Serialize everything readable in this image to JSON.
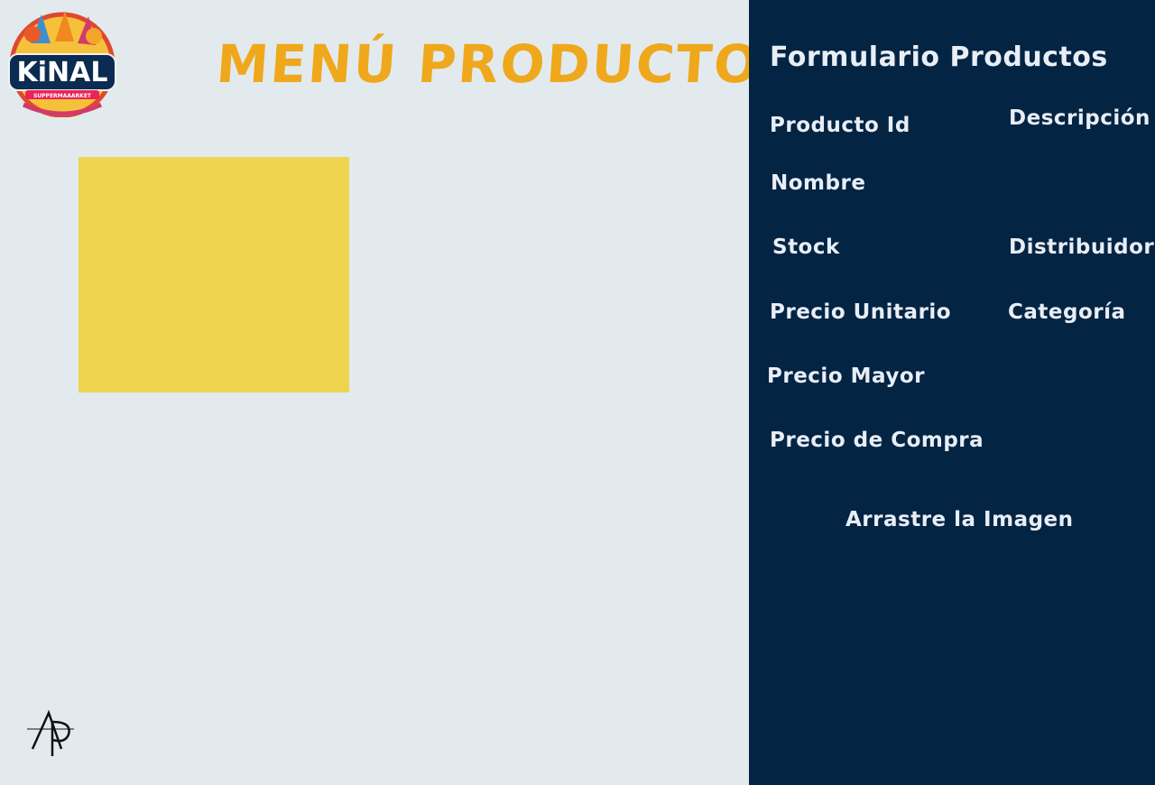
{
  "header": {
    "title": "MENÚ PRODUCTOS",
    "logo": {
      "name": "kinal-supermarket-logo",
      "text": "KiNAL",
      "subtext": "SUPPERMAAARKET"
    }
  },
  "main": {
    "image_preview": {
      "color": "#efd44f"
    }
  },
  "footer": {
    "author_mark": "AP"
  },
  "form": {
    "title": "Formulario Productos",
    "labels": {
      "producto_id": "Producto Id",
      "descripcion": "Descripción",
      "nombre": "Nombre",
      "stock": "Stock",
      "distribuidor": "Distribuidor",
      "precio_unitario": "Precio Unitario",
      "categoria": "Categoría",
      "precio_mayor": "Precio Mayor",
      "precio_compra": "Precio de Compra"
    },
    "drop_zone_label": "Arrastre la Imagen"
  },
  "colors": {
    "background": "#e2eaed",
    "sidebar": "#032442",
    "accent": "#efa81c",
    "label_text": "#e8eef6"
  }
}
